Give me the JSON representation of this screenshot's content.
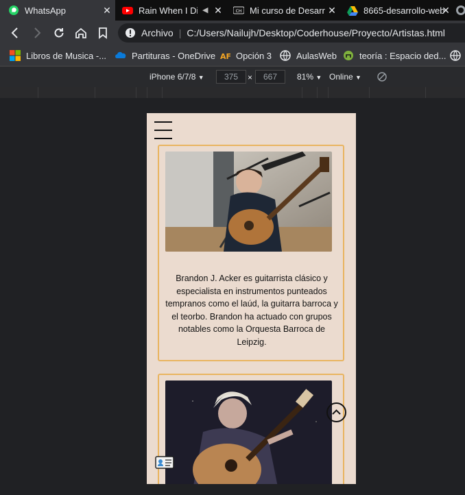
{
  "tabs": [
    {
      "title": "WhatsApp",
      "icon": "whatsapp-icon"
    },
    {
      "title": "Rain When I Die",
      "icon": "youtube-icon"
    },
    {
      "title": "Mi curso de Desarrollo",
      "icon": "coderhouse-icon"
    },
    {
      "title": "8665-desarrollo-web",
      "icon": "google-drive-icon"
    }
  ],
  "omnibox": {
    "scheme": "Archivo",
    "url": "C:/Users/Nailujh/Desktop/Coderhouse/Proyecto/Artistas.html"
  },
  "bookmarks": [
    {
      "label": "Libros de Musica -...",
      "icon": "microsoft-icon"
    },
    {
      "label": "Partituras - OneDrive",
      "icon": "onedrive-icon"
    },
    {
      "label": "Opción 3",
      "icon": "af-icon"
    },
    {
      "label": "AulasWeb",
      "icon": "globe-icon"
    },
    {
      "label": "teoría : Espacio ded...",
      "icon": "moodle-icon"
    }
  ],
  "devtools": {
    "device": "iPhone 6/7/8",
    "width": "375",
    "height": "667",
    "times": "×",
    "zoom": "81%",
    "network": "Online"
  },
  "page": {
    "cards": [
      {
        "text": "Brandon J. Acker es guitarrista clásico y especialista en instrumentos punteados tempranos como el laúd, la guitarra barroca y el teorbo. Brandon ha actuado con grupos notables como la Orquesta Barroca de Leipzig."
      },
      {
        "text": ""
      }
    ]
  },
  "colors": {
    "page_bg": "#ebdbcf",
    "card_border": "#e9b45f",
    "chrome_dark": "#202124"
  }
}
